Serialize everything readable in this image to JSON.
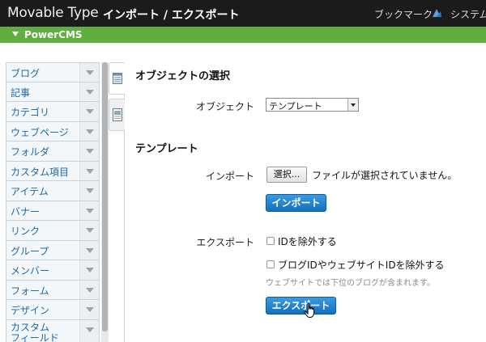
{
  "header": {
    "brand": "Movable Type",
    "title": "インポート / エクスポート",
    "bookmark_label": "ブックマーク",
    "system_label": "システム"
  },
  "site_bar": {
    "name": "PowerCMS"
  },
  "sidebar": {
    "items": [
      {
        "label": "ブログ"
      },
      {
        "label": "記事"
      },
      {
        "label": "カテゴリ"
      },
      {
        "label": "ウェブページ"
      },
      {
        "label": "フォルダ"
      },
      {
        "label": "カスタム項目"
      },
      {
        "label": "アイテム"
      },
      {
        "label": "バナー"
      },
      {
        "label": "リンク"
      },
      {
        "label": "グループ"
      },
      {
        "label": "メンバー"
      },
      {
        "label": "フォーム"
      },
      {
        "label": "デザイン"
      },
      {
        "label": "カスタム\nフィールド"
      }
    ]
  },
  "main": {
    "object_section_title": "オブジェクトの選択",
    "object_label": "オブジェクト",
    "object_value": "テンプレート",
    "template_section_title": "テンプレート",
    "import_label": "インポート",
    "choose_file_label": "選択...",
    "file_status": "ファイルが選択されていません。",
    "import_button": "インポート",
    "export_label": "エクスポート",
    "exclude_id_label": "IDを除外する",
    "exclude_blog_id_label": "ブログIDやウェブサイトIDを除外する",
    "hint": "ウェブサイトでは下位のブログが含まれます。",
    "export_button": "エクスポート"
  },
  "icons": {
    "bookmark": "bookmark-icon",
    "tab1": "calendar-icon",
    "tab2": "document-icon",
    "cursor": "hand-pointer-icon"
  },
  "colors": {
    "top_bar": "#1b1b1b",
    "site_bar": "#5fae3f",
    "link": "#1b6aa5",
    "button": "#1670bd"
  }
}
